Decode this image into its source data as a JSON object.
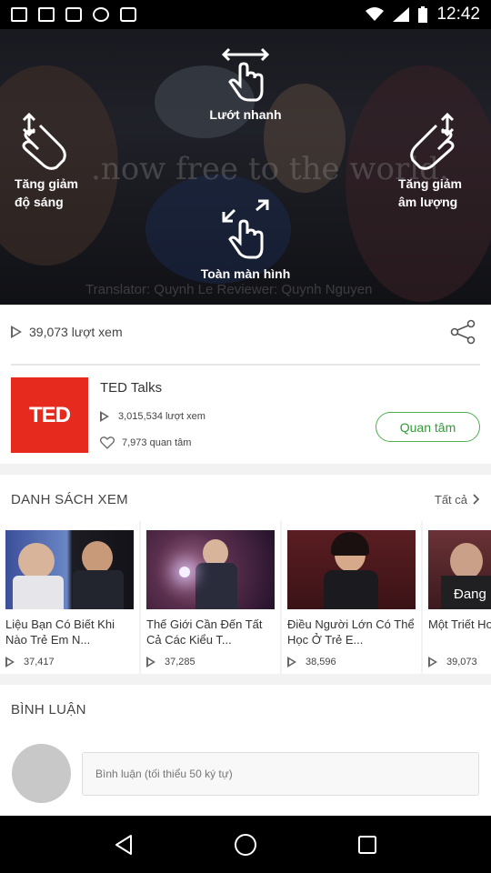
{
  "status_bar": {
    "time": "12:42"
  },
  "gestures": {
    "brightness": "Tăng giảm\nđộ sáng",
    "seek": "Lướt nhanh",
    "volume": "Tăng giảm\nâm lượng",
    "fullscreen": "Toàn màn hình"
  },
  "video": {
    "bg_text": ".now free to the world.",
    "caption": "Translator: Quynh Le  Reviewer: Quynh Nguyen"
  },
  "talk": {
    "views": "39,073 lượt xem"
  },
  "channel": {
    "logo_text": "TED",
    "name": "TED Talks",
    "views": "3,015,534 lượt xem",
    "followers": "7,973 quan tâm",
    "follow_label": "Quan tâm"
  },
  "watchlist": {
    "title": "DANH SÁCH XEM",
    "see_all": "Tất cả",
    "items": [
      {
        "title": "Liệu Bạn Có Biết Khi Nào Trẻ Em N...",
        "views": "37,417"
      },
      {
        "title": "Thế Giới Cần Đến Tất Cả Các Kiểu T...",
        "views": "37,285"
      },
      {
        "title": "Điều Người Lớn Có Thể Học Ở Trẻ E...",
        "views": "38,596"
      },
      {
        "title": "Một Triết Hơn, Nhẹ",
        "views": "39,073",
        "badge": "Đang"
      }
    ]
  },
  "comments": {
    "title": "BÌNH LUẬN",
    "placeholder": "Bình luận (tối thiểu 50 ký tự)"
  },
  "colors": {
    "accent_green": "#4caf50",
    "ted_red": "#e62b1e"
  }
}
